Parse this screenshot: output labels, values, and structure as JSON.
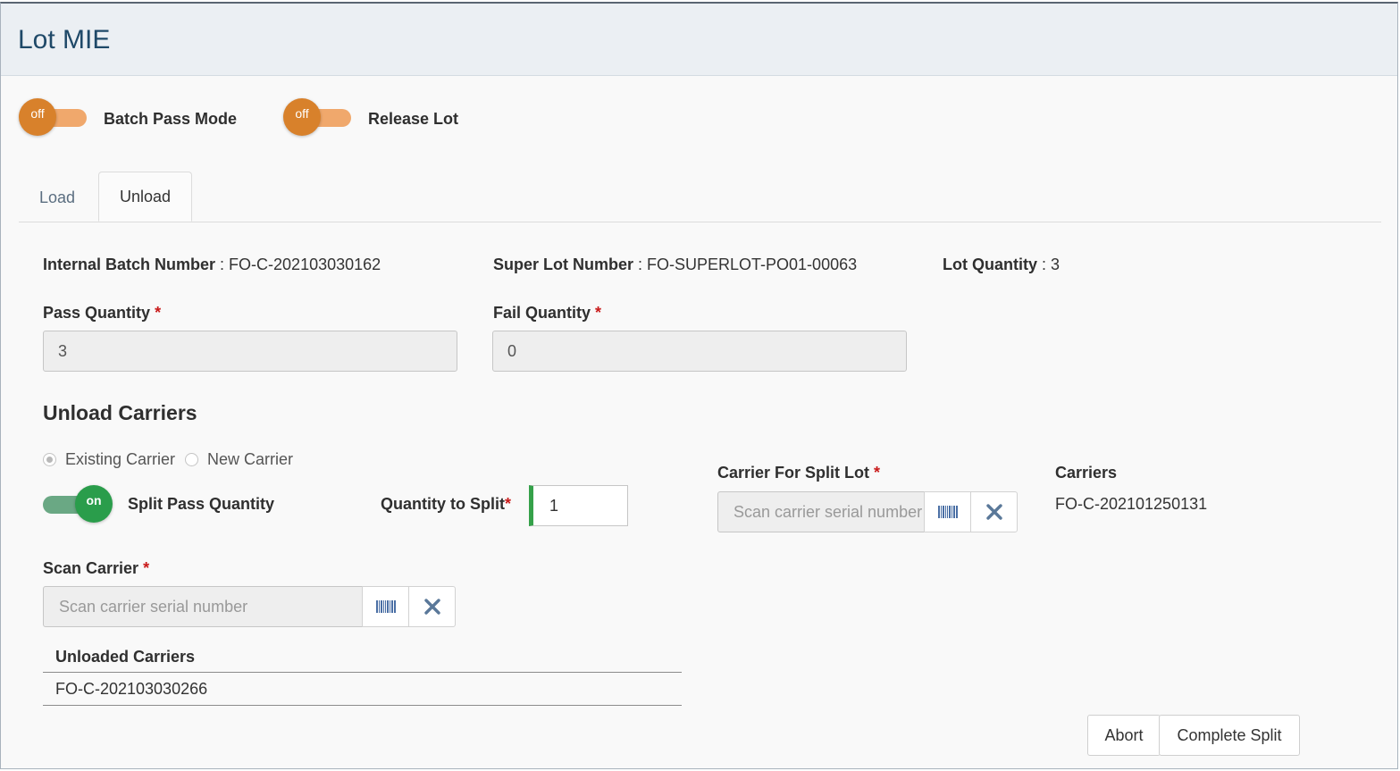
{
  "app": {
    "title": "Lot MIE"
  },
  "toggles": {
    "batch_pass": {
      "state": "off",
      "label": "Batch Pass Mode"
    },
    "release_lot": {
      "state": "off",
      "label": "Release Lot"
    },
    "split_pass": {
      "state": "on",
      "label": "Split Pass Quantity"
    }
  },
  "tabs": [
    {
      "label": "Load",
      "active": false
    },
    {
      "label": "Unload",
      "active": true
    }
  ],
  "info": {
    "internal_batch_label": "Internal Batch Number",
    "internal_batch_value": " : FO-C-202103030162",
    "super_lot_label": "Super Lot Number",
    "super_lot_value": " : FO-SUPERLOT-PO01-00063",
    "lot_qty_label": "Lot Quantity",
    "lot_qty_value": " : 3"
  },
  "form": {
    "pass_qty_label": "Pass Quantity",
    "pass_qty_value": "3",
    "fail_qty_label": "Fail Quantity",
    "fail_qty_value": "0",
    "required_mark": "*"
  },
  "unload_carriers": {
    "title": "Unload Carriers",
    "radio_existing": "Existing Carrier",
    "radio_new": "New Carrier",
    "selected": "existing",
    "qty_to_split_label": "Quantity to Split",
    "qty_to_split_value": "1",
    "carrier_split_label": "Carrier For Split Lot",
    "carrier_split_placeholder": "Scan carrier serial number",
    "carriers_label": "Carriers",
    "carriers_value": "FO-C-202101250131",
    "scan_carrier_label": "Scan Carrier",
    "scan_carrier_placeholder": "Scan carrier serial number"
  },
  "unloaded_table": {
    "header": "Unloaded Carriers",
    "rows": [
      "FO-C-202103030266"
    ]
  },
  "actions": {
    "abort": "Abort",
    "complete": "Complete Split"
  },
  "colors": {
    "toggle_off": "#d8812b",
    "toggle_on": "#2a9d4b",
    "header_bg": "#ebeff3",
    "title": "#1f4968"
  },
  "icons": {
    "barcode": "barcode-icon",
    "clear": "close-icon"
  }
}
